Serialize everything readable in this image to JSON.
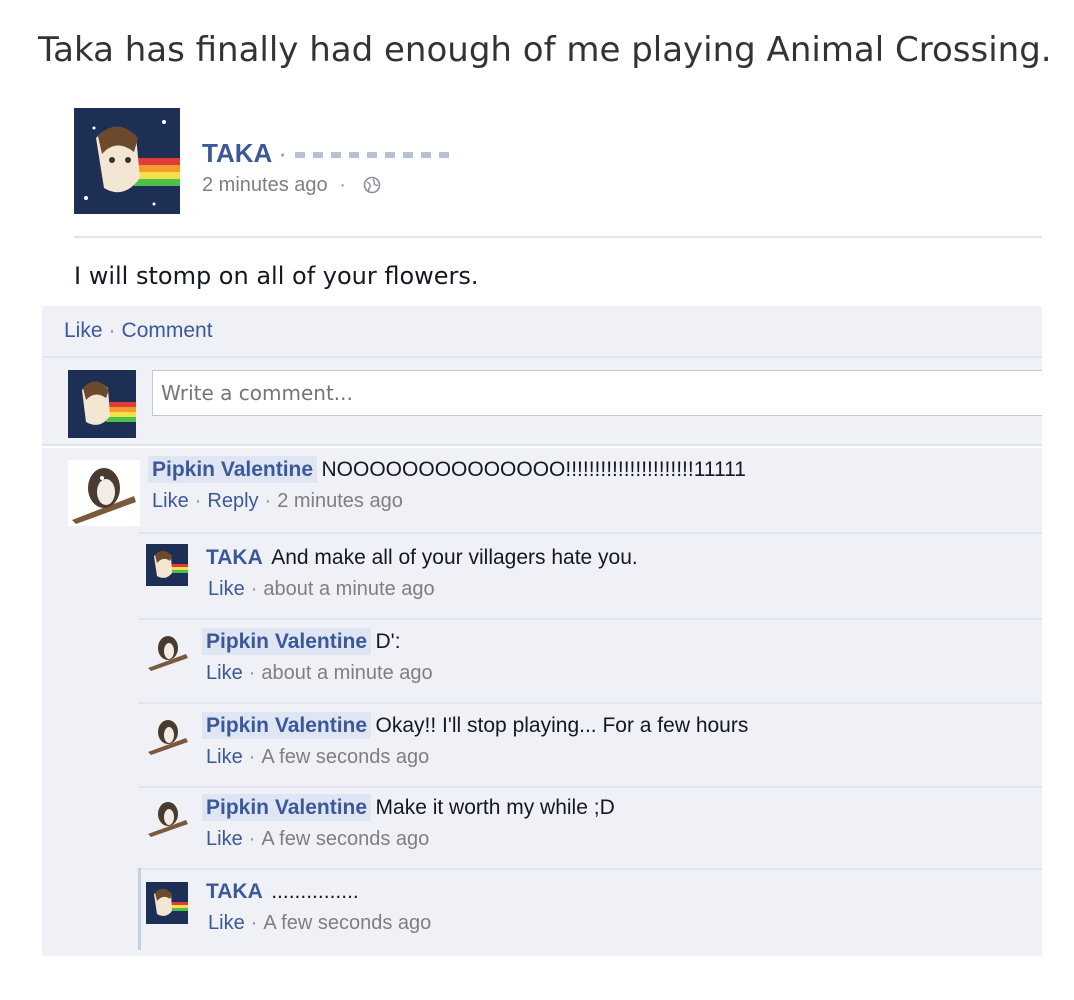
{
  "caption": "Taka has finally had enough of me playing Animal Crossing.",
  "post": {
    "author": "TAKA",
    "author_sep": "·",
    "time": "2 minutes ago",
    "time_sep": "·",
    "text": "I will stomp on all of your flowers."
  },
  "actions": {
    "like": "Like",
    "sep": "·",
    "comment": "Comment"
  },
  "write_comment": {
    "placeholder": "Write a comment..."
  },
  "comments": [
    {
      "author": "Pipkin Valentine",
      "text": "NOOOOOOOOOOOOOO!!!!!!!!!!!!!!!!!!!!!!11111",
      "like": "Like",
      "reply": "Reply",
      "time": "2 minutes ago",
      "replies": [
        {
          "author": "TAKA",
          "text": "And make all of your villagers hate you.",
          "like": "Like",
          "time": "about a minute ago"
        },
        {
          "author": "Pipkin Valentine",
          "text": "D':",
          "like": "Like",
          "time": "about a minute ago"
        },
        {
          "author": "Pipkin Valentine",
          "text": "Okay!! I'll stop playing... For a few hours",
          "like": "Like",
          "time": "A few seconds ago"
        },
        {
          "author": "Pipkin Valentine",
          "text": "Make it worth my while ;D",
          "like": "Like",
          "time": "A few seconds ago"
        },
        {
          "author": "TAKA",
          "text": "...............",
          "like": "Like",
          "time": "A few seconds ago"
        }
      ]
    }
  ],
  "colors": {
    "link": "#3b5998",
    "panel": "#eff1f6",
    "name_highlight": "#dfe5f3",
    "meta": "#7f7f7f"
  },
  "icons": {
    "privacy": "globe-icon"
  }
}
